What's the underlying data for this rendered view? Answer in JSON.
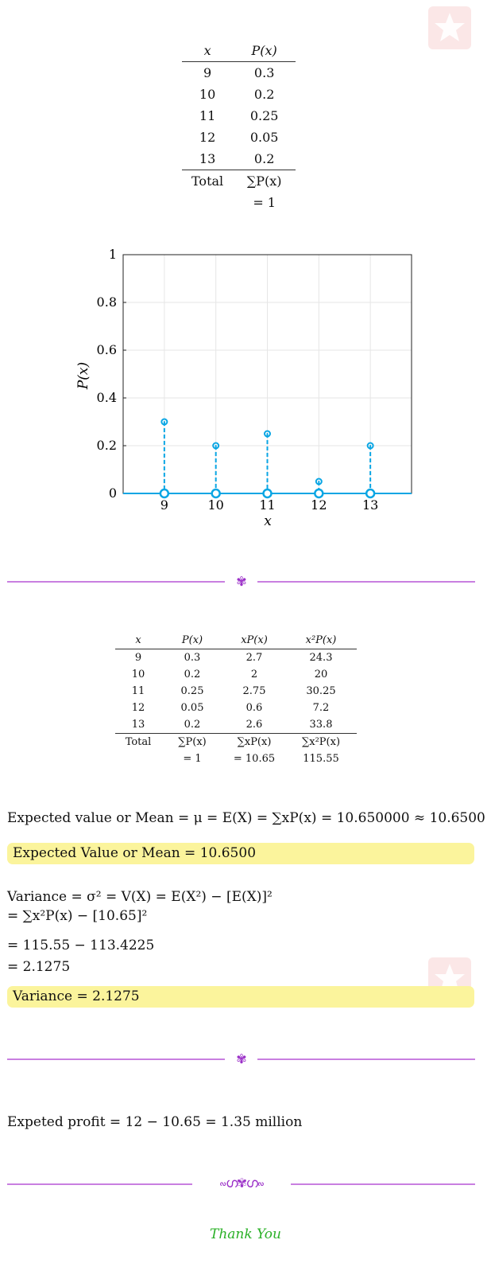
{
  "table1": {
    "headers": [
      "x",
      "P(x)"
    ],
    "rows": [
      [
        "9",
        "0.3"
      ],
      [
        "10",
        "0.2"
      ],
      [
        "11",
        "0.25"
      ],
      [
        "12",
        "0.05"
      ],
      [
        "13",
        "0.2"
      ]
    ],
    "total_label": "Total",
    "total_formula": "∑P(x)",
    "total_value": "= 1"
  },
  "chart_data": {
    "type": "stem",
    "x": [
      9,
      10,
      11,
      12,
      13
    ],
    "values": [
      0.3,
      0.2,
      0.25,
      0.05,
      0.2
    ],
    "xlabel": "x",
    "ylabel": "P(x)",
    "ylim": [
      0,
      1
    ],
    "xlim": [
      8.2,
      13.8
    ],
    "yticks": [
      "0",
      "0.2",
      "0.4",
      "0.6",
      "0.8",
      "1"
    ],
    "xticks": [
      "9",
      "10",
      "11",
      "12",
      "13"
    ],
    "grid": true,
    "color": "#0aa6e4"
  },
  "table2": {
    "headers": [
      "x",
      "P(x)",
      "xP(x)",
      "x²P(x)"
    ],
    "rows": [
      [
        "9",
        "0.3",
        "2.7",
        "24.3"
      ],
      [
        "10",
        "0.2",
        "2",
        "20"
      ],
      [
        "11",
        "0.25",
        "2.75",
        "30.25"
      ],
      [
        "12",
        "0.05",
        "0.6",
        "7.2"
      ],
      [
        "13",
        "0.2",
        "2.6",
        "33.8"
      ]
    ],
    "total_label": "Total",
    "total_formulas": [
      "∑P(x)",
      "∑xP(x)",
      "∑x²P(x)"
    ],
    "total_values": [
      "= 1",
      "= 10.65",
      "115.55"
    ]
  },
  "mean": {
    "equation": "Expected value or Mean = μ = E(X) = ∑xP(x) = 10.650000 ≈ 10.6500",
    "highlight": "Expected Value or Mean = 10.6500"
  },
  "variance": {
    "line1": "Variance = σ² = V(X) = E(X²) − [E(X)]²",
    "line2": "= ∑x²P(x) − [10.65]²",
    "line3": "= 115.55 − 113.4225",
    "line4": "= 2.1275",
    "highlight": "Variance = 2.1275"
  },
  "profit": {
    "equation": "Expeted profit = 12 − 10.65 = 1.35 million"
  },
  "closing": "Thank You",
  "colors": {
    "accent": "#0aa6e4",
    "divider": "#c97fe0",
    "ornament": "#9b30c8",
    "highlight": "#fbf49c",
    "thanks": "#29b026"
  }
}
